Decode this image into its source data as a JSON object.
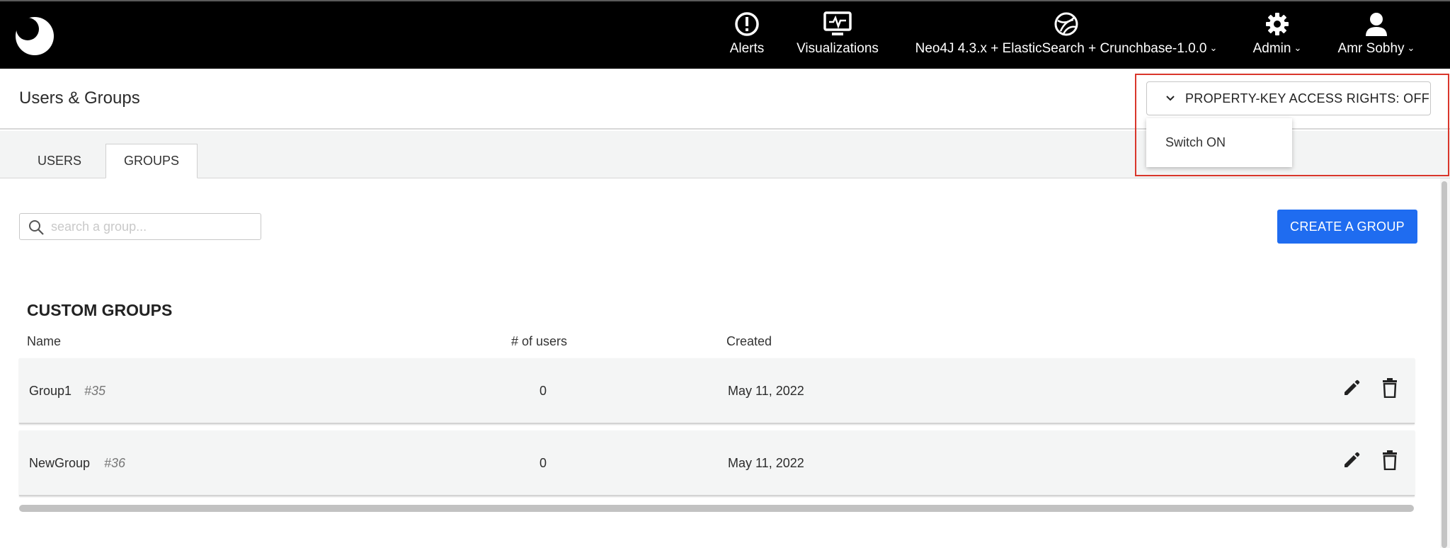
{
  "nav": {
    "alerts": "Alerts",
    "visualizations": "Visualizations",
    "datasource": "Neo4J 4.3.x + ElasticSearch + Crunchbase-1.0.0",
    "admin": "Admin",
    "user": "Amr Sobhy",
    "caret": "⌄"
  },
  "header": {
    "title": "Users & Groups",
    "property_button": "PROPERTY-KEY ACCESS RIGHTS: OFF",
    "dropdown_item": "Switch ON"
  },
  "tabs": [
    {
      "label": "USERS",
      "active": false
    },
    {
      "label": "GROUPS",
      "active": true
    }
  ],
  "search": {
    "placeholder": "search a group..."
  },
  "create_button": "CREATE A GROUP",
  "section_title": "CUSTOM GROUPS",
  "columns": {
    "name": "Name",
    "users": "# of users",
    "created": "Created"
  },
  "groups": [
    {
      "name": "Group1",
      "id": "#35",
      "users": "0",
      "created": "May 11, 2022"
    },
    {
      "name": "NewGroup",
      "id": "#36",
      "users": "0",
      "created": "May 11, 2022"
    }
  ],
  "colors": {
    "topbar": "#000000",
    "primary_button": "#1f6cf0",
    "highlight": "#d9362b"
  }
}
